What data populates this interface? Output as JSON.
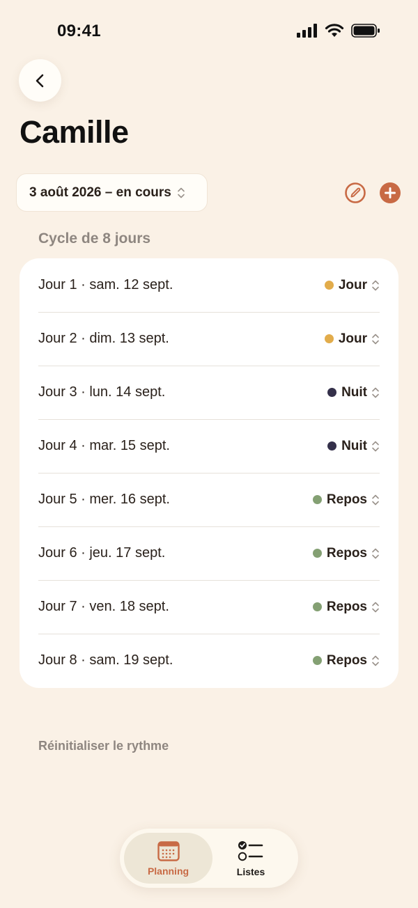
{
  "status_bar": {
    "time": "09:41"
  },
  "header": {
    "title": "Camille"
  },
  "toolbar": {
    "date_range_label": "3 août 2026 – en cours"
  },
  "cycle": {
    "title": "Cycle de 8 jours",
    "days": [
      {
        "label": "Jour 1 · sam. 12 sept.",
        "shift": "Jour",
        "color": "#E2AC4B"
      },
      {
        "label": "Jour 2 · dim. 13 sept.",
        "shift": "Jour",
        "color": "#E2AC4B"
      },
      {
        "label": "Jour 3 · lun. 14 sept.",
        "shift": "Nuit",
        "color": "#34304A"
      },
      {
        "label": "Jour 4 · mar. 15 sept.",
        "shift": "Nuit",
        "color": "#34304A"
      },
      {
        "label": "Jour 5 · mer. 16 sept.",
        "shift": "Repos",
        "color": "#84A073"
      },
      {
        "label": "Jour 6 · jeu. 17 sept.",
        "shift": "Repos",
        "color": "#84A073"
      },
      {
        "label": "Jour 7 · ven. 18 sept.",
        "shift": "Repos",
        "color": "#84A073"
      },
      {
        "label": "Jour 8 · sam. 19 sept.",
        "shift": "Repos",
        "color": "#84A073"
      }
    ]
  },
  "reset_label": "Réinitialiser le rythme",
  "tab_bar": {
    "tabs": [
      {
        "label": "Planning",
        "icon": "calendar-icon",
        "active": true
      },
      {
        "label": "Listes",
        "icon": "checklist-icon",
        "active": false
      }
    ]
  },
  "colors": {
    "accent": "#C86A45",
    "background": "#FAF1E6"
  }
}
